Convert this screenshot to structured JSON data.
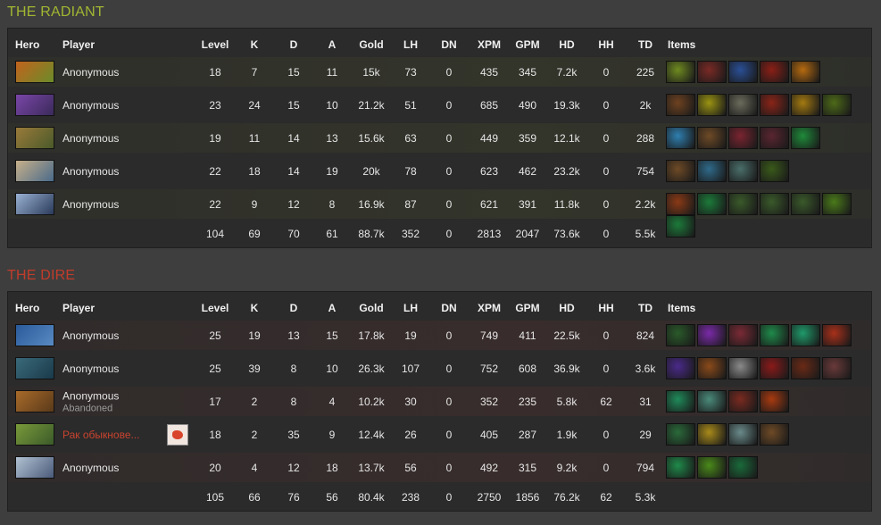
{
  "columns": {
    "hero": "Hero",
    "player": "Player",
    "level": "Level",
    "k": "K",
    "d": "D",
    "a": "A",
    "gold": "Gold",
    "lh": "LH",
    "dn": "DN",
    "xpm": "XPM",
    "gpm": "GPM",
    "hd": "HD",
    "hh": "HH",
    "td": "TD",
    "items": "Items"
  },
  "teams": [
    {
      "title": "THE RADIANT",
      "players": [
        {
          "hero_icon": "hero-portrait-icon",
          "hero_colors": [
            "#c2631d",
            "#6b8c2a"
          ],
          "name": "Anonymous",
          "sub": "",
          "level": "18",
          "k": "7",
          "d": "15",
          "a": "11",
          "gold": "15k",
          "lh": "73",
          "dn": "0",
          "xpm": "435",
          "gpm": "345",
          "hd": "7.2k",
          "hh": "0",
          "td": "225",
          "items": [
            "#6f8a20",
            "#7a2a25",
            "#2a4f96",
            "#8a1f16",
            "#b56a0f"
          ]
        },
        {
          "hero_icon": "hero-portrait-icon",
          "hero_colors": [
            "#7a46a8",
            "#3a2a5a"
          ],
          "name": "Anonymous",
          "sub": "",
          "level": "23",
          "k": "24",
          "d": "15",
          "a": "10",
          "gold": "21.2k",
          "lh": "51",
          "dn": "0",
          "xpm": "685",
          "gpm": "490",
          "hd": "19.3k",
          "hh": "0",
          "td": "2k",
          "items": [
            "#6e4220",
            "#9a9312",
            "#6b6b5c",
            "#8a2418",
            "#a47a10",
            "#4d6a18"
          ]
        },
        {
          "hero_icon": "hero-portrait-icon",
          "hero_colors": [
            "#9a7a3a",
            "#4a5a2a"
          ],
          "name": "Anonymous",
          "sub": "",
          "level": "19",
          "k": "11",
          "d": "14",
          "a": "13",
          "gold": "15.6k",
          "lh": "63",
          "dn": "0",
          "xpm": "449",
          "gpm": "359",
          "hd": "12.1k",
          "hh": "0",
          "td": "288",
          "items": [
            "#2f7fb0",
            "#6e4a26",
            "#7a2430",
            "#5a2530",
            "#1f8a3a"
          ]
        },
        {
          "hero_icon": "hero-portrait-icon",
          "hero_colors": [
            "#c7b08a",
            "#4a6a8a"
          ],
          "name": "Anonymous",
          "sub": "",
          "level": "22",
          "k": "18",
          "d": "14",
          "a": "19",
          "gold": "20k",
          "lh": "78",
          "dn": "0",
          "xpm": "623",
          "gpm": "462",
          "hd": "23.2k",
          "hh": "0",
          "td": "754",
          "items": [
            "#6e4a26",
            "#2f6a8a",
            "#4a6e6a",
            "#3a5a1a"
          ]
        },
        {
          "hero_icon": "hero-portrait-icon",
          "hero_colors": [
            "#9ab2d2",
            "#2a3a5a"
          ],
          "name": "Anonymous",
          "sub": "",
          "level": "22",
          "k": "9",
          "d": "12",
          "a": "8",
          "gold": "16.9k",
          "lh": "87",
          "dn": "0",
          "xpm": "621",
          "gpm": "391",
          "hd": "11.8k",
          "hh": "0",
          "td": "2.2k",
          "items": [
            "#8a3a16",
            "#1c7a3a",
            "#3a5a2a",
            "#3a5a2a",
            "#3a5a2a",
            "#4a7a1a",
            "#1c7a3a"
          ]
        }
      ],
      "totals": {
        "level": "104",
        "k": "69",
        "d": "70",
        "a": "61",
        "gold": "88.7k",
        "lh": "352",
        "dn": "0",
        "xpm": "2813",
        "gpm": "2047",
        "hd": "73.6k",
        "hh": "0",
        "td": "5.5k"
      }
    },
    {
      "title": "THE DIRE",
      "players": [
        {
          "hero_icon": "hero-portrait-icon",
          "hero_colors": [
            "#2a5a9a",
            "#5a8ac2"
          ],
          "name": "Anonymous",
          "sub": "",
          "level": "25",
          "k": "19",
          "d": "13",
          "a": "15",
          "gold": "17.8k",
          "lh": "19",
          "dn": "0",
          "xpm": "749",
          "gpm": "411",
          "hd": "22.5k",
          "hh": "0",
          "td": "824",
          "items": [
            "#2a5a2a",
            "#7a2aa8",
            "#7a2a35",
            "#1f8a4a",
            "#1f9a6a",
            "#a8301a"
          ]
        },
        {
          "hero_icon": "hero-portrait-icon",
          "hero_colors": [
            "#3a6a7a",
            "#1a3a4a"
          ],
          "name": "Anonymous",
          "sub": "",
          "level": "25",
          "k": "39",
          "d": "8",
          "a": "10",
          "gold": "26.3k",
          "lh": "107",
          "dn": "0",
          "xpm": "752",
          "gpm": "608",
          "hd": "36.9k",
          "hh": "0",
          "td": "3.6k",
          "items": [
            "#4a2a8a",
            "#8a4a1a",
            "#8a8a8a",
            "#8a1a1a",
            "#6a2a16",
            "#6a3a3a"
          ]
        },
        {
          "hero_icon": "hero-portrait-icon",
          "hero_colors": [
            "#a86a2a",
            "#5a3a1a"
          ],
          "name": "Anonymous",
          "sub": "Abandoned",
          "level": "17",
          "k": "2",
          "d": "8",
          "a": "4",
          "gold": "10.2k",
          "lh": "30",
          "dn": "0",
          "xpm": "352",
          "gpm": "235",
          "hd": "5.8k",
          "hh": "62",
          "td": "31",
          "items": [
            "#1f8a5a",
            "#4a8a7a",
            "#7a2a20",
            "#a83a10"
          ]
        },
        {
          "hero_icon": "hero-portrait-icon",
          "hero_colors": [
            "#7a9a3a",
            "#3a5a2a"
          ],
          "name": "Рак обыкнове...",
          "sub": "",
          "red": true,
          "avatar": true,
          "level": "18",
          "k": "2",
          "d": "35",
          "a": "9",
          "gold": "12.4k",
          "lh": "26",
          "dn": "0",
          "xpm": "405",
          "gpm": "287",
          "hd": "1.9k",
          "hh": "0",
          "td": "29",
          "items": [
            "#2a6a3a",
            "#a88a1a",
            "#6a8a8a",
            "#6e4a26"
          ]
        },
        {
          "hero_icon": "hero-portrait-icon",
          "hero_colors": [
            "#b2c2d2",
            "#4a5a7a"
          ],
          "name": "Anonymous",
          "sub": "",
          "level": "20",
          "k": "4",
          "d": "12",
          "a": "18",
          "gold": "13.7k",
          "lh": "56",
          "dn": "0",
          "xpm": "492",
          "gpm": "315",
          "hd": "9.2k",
          "hh": "0",
          "td": "794",
          "items": [
            "#1f8a4a",
            "#4a8a1a",
            "#1a6a3a"
          ]
        }
      ],
      "totals": {
        "level": "105",
        "k": "66",
        "d": "76",
        "a": "56",
        "gold": "80.4k",
        "lh": "238",
        "dn": "0",
        "xpm": "2750",
        "gpm": "1856",
        "hd": "76.2k",
        "hh": "62",
        "td": "5.3k"
      }
    }
  ]
}
